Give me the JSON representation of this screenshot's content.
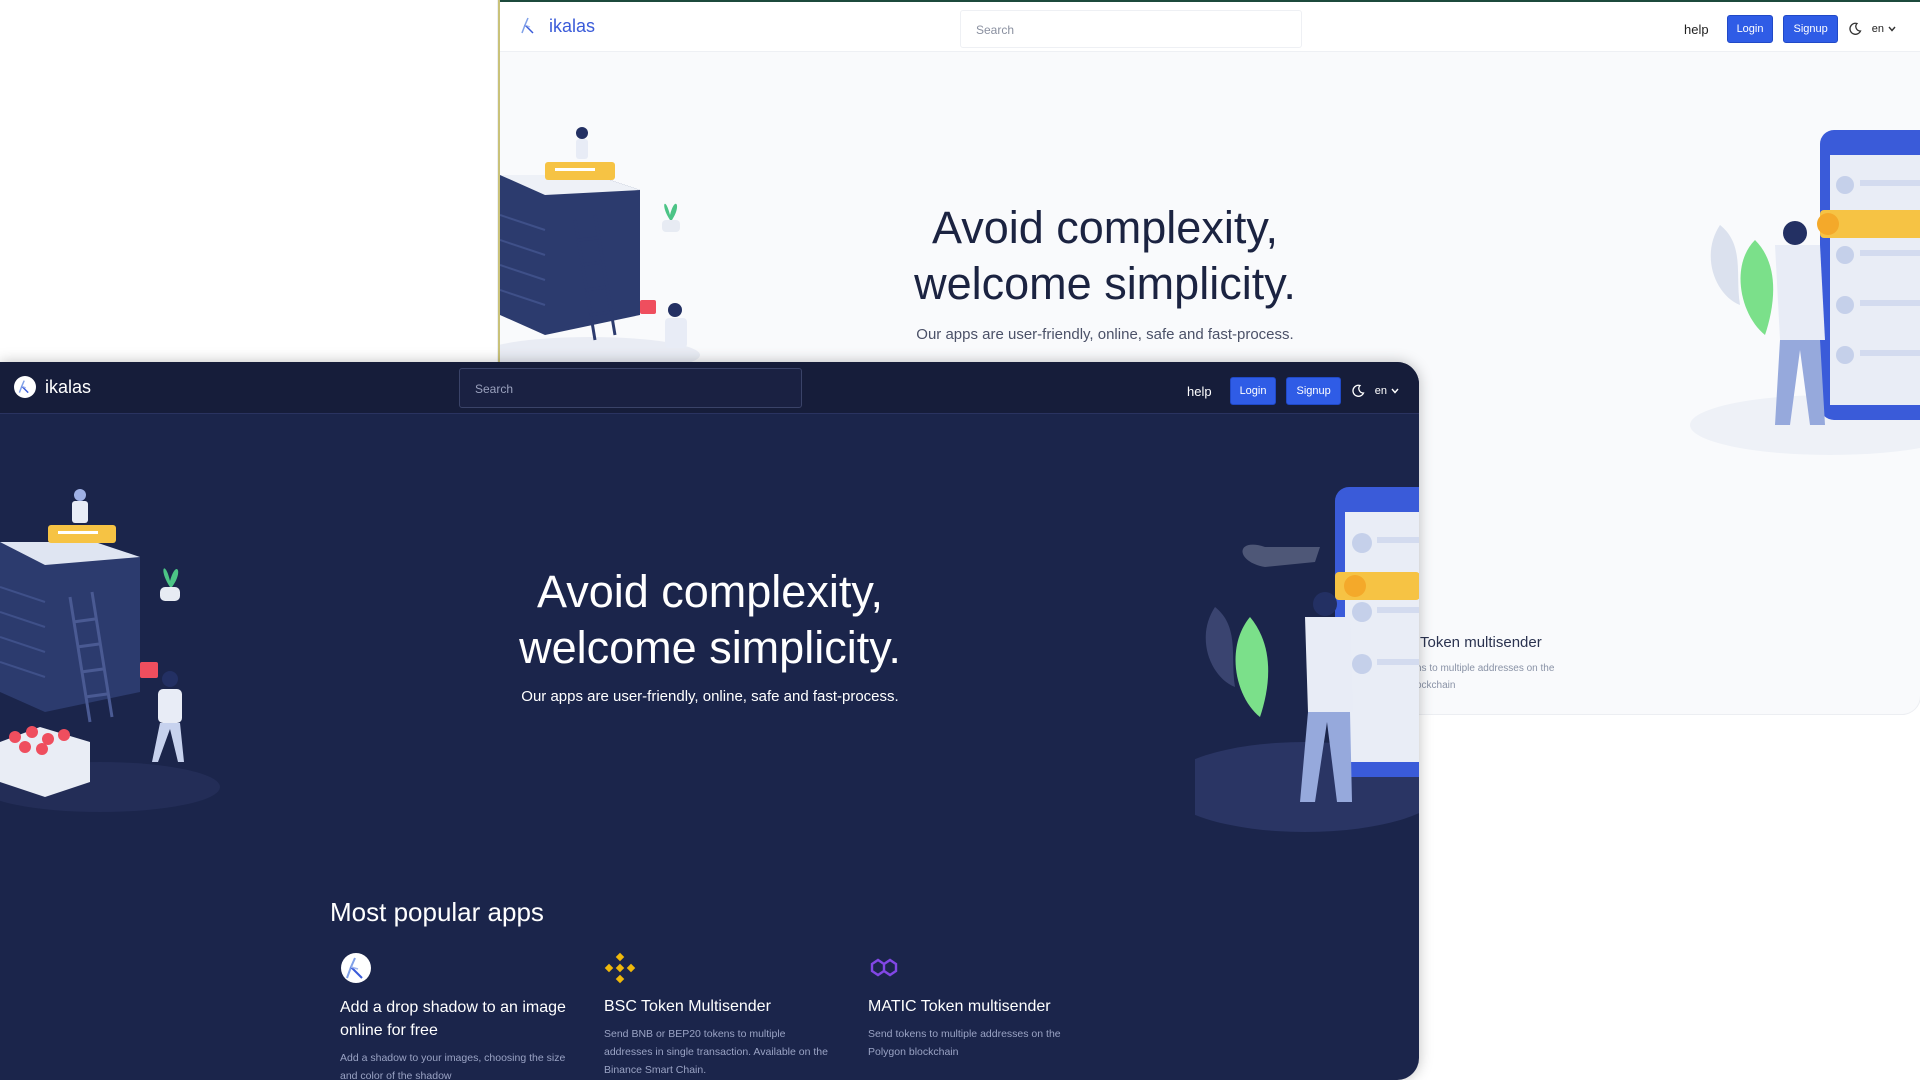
{
  "light_window": {
    "brand": "ikalas",
    "search": {
      "placeholder": "Search"
    },
    "nav": {
      "help": "help",
      "login": "Login",
      "signup": "Signup",
      "lang": "en"
    },
    "hero": {
      "title_line1": "Avoid complexity,",
      "title_line2": "welcome simplicity.",
      "subtitle": "Our apps are user-friendly, online, safe and fast-process."
    },
    "peek_card": {
      "title": "Token multisender",
      "desc_line1": "ns to multiple addresses on the",
      "desc_line2": "ockchain"
    }
  },
  "dark_window": {
    "brand": "ikalas",
    "search": {
      "placeholder": "Search"
    },
    "nav": {
      "help": "help",
      "login": "Login",
      "signup": "Signup",
      "lang": "en"
    },
    "hero": {
      "title_line1": "Avoid complexity,",
      "title_line2": "welcome simplicity.",
      "subtitle": "Our apps are user-friendly, online, safe and fast-process."
    },
    "section_title": "Most popular apps",
    "apps": [
      {
        "icon": "ikalas-logo-icon",
        "title": "Add a drop shadow to an image online for free",
        "description": "Add a shadow to your images, choosing the size and color of the shadow"
      },
      {
        "icon": "binance-icon",
        "title": "BSC Token Multisender",
        "description": "Send BNB or BEP20 tokens to multiple addresses in single transaction. Available on the Binance Smart Chain."
      },
      {
        "icon": "polygon-icon",
        "title": "MATIC Token multisender",
        "description": "Send tokens to multiple addresses on the Polygon blockchain"
      }
    ]
  },
  "colors": {
    "accent": "#2f5ce6",
    "dark_bg": "#1b254b",
    "dark_nav": "#161d3a",
    "light_bg": "#f9fafc",
    "binance": "#f0b90b",
    "polygon": "#8247e5"
  }
}
